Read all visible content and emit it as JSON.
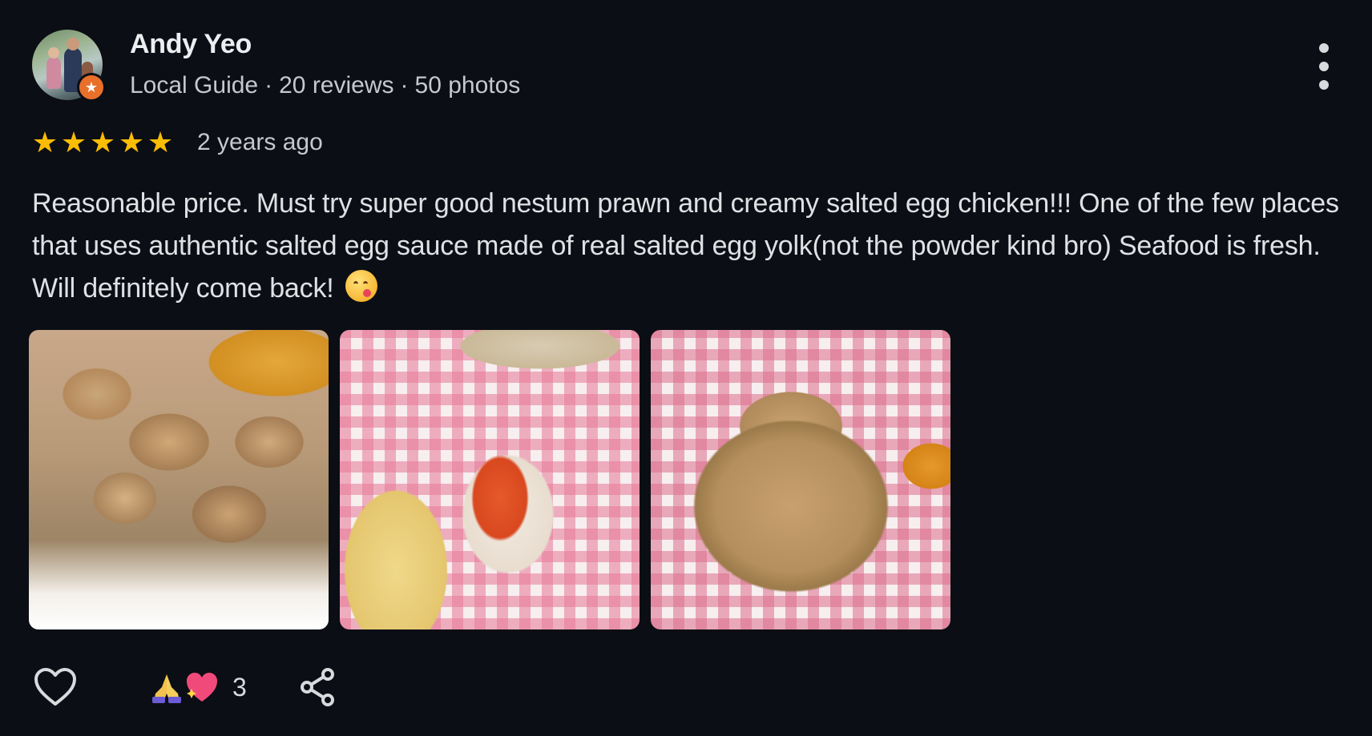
{
  "reviewer": {
    "name": "Andy Yeo",
    "badge": "Local Guide",
    "reviews": "20 reviews",
    "photos": "50 photos",
    "separator": "·"
  },
  "rating": {
    "stars": 5,
    "max": 5,
    "time": "2 years ago",
    "star_color": "#fbbc04"
  },
  "review": {
    "text": "Reasonable price. Must try super good nestum prawn and creamy salted egg chicken!!! One of the few places that uses authentic salted egg sauce made of real salted egg yolk(not the powder kind bro) Seafood is fresh. Will definitely come back!",
    "emoji": "face-savoring-food"
  },
  "photos": [
    {
      "subject": "creamy salted egg chicken"
    },
    {
      "subject": "prawn on fork with rice"
    },
    {
      "subject": "nestum prawn"
    }
  ],
  "actions": {
    "like_icon": "heart-outline-icon",
    "reactions": [
      "folded-hands",
      "sparkling-heart"
    ],
    "reaction_count": "3",
    "share_icon": "share-icon",
    "more_icon": "more-vert-icon"
  },
  "colors": {
    "background": "#0b0e14",
    "badge_orange": "#e8702a",
    "text_primary": "#e8eaed",
    "text_secondary": "#c5c8cd"
  }
}
